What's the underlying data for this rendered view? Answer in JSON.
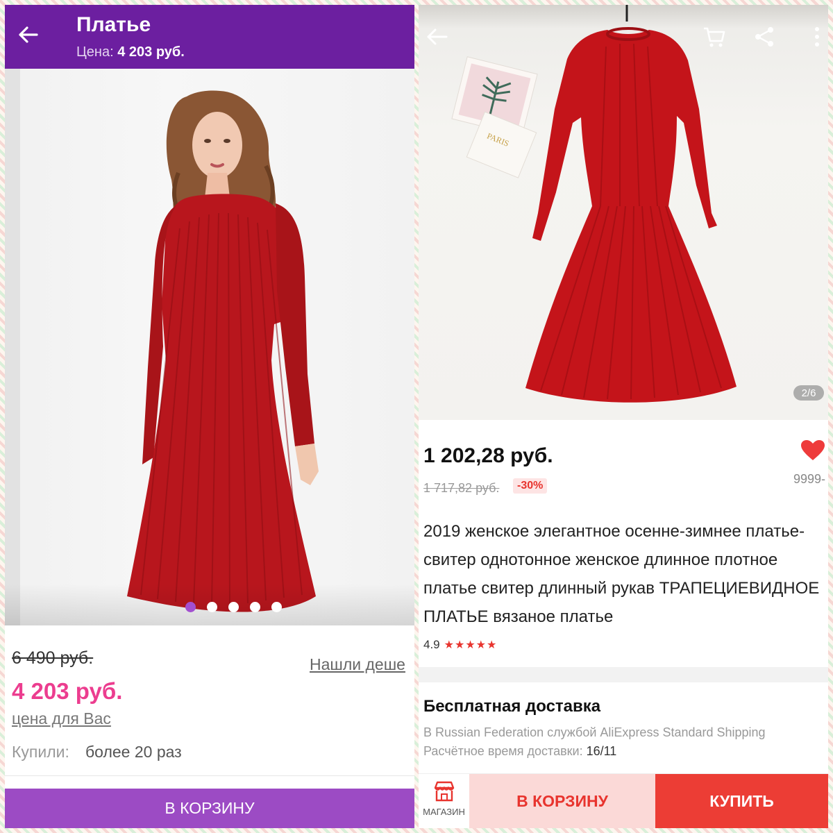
{
  "left": {
    "header": {
      "title": "Платье",
      "price_label": "Цена:",
      "price_value": "4 203 руб."
    },
    "gallery": {
      "dots_count": 5,
      "active_index": 0
    },
    "old_price": "6 490 руб.",
    "found_cheaper": "Нашли деше",
    "price": "4 203 руб.",
    "price_for_you": "цена для Вас",
    "bought_label": "Купили:",
    "bought_value": "более 20 раз",
    "cart_button": "В КОРЗИНУ"
  },
  "right": {
    "photo_counter": "2/6",
    "price": "1 202,28 руб.",
    "old_price": "1 717,82 руб.",
    "discount": "-30%",
    "likes": "9999-",
    "description": "2019 женское элегантное осенне-зимнее платье-свитер однотонное женское длинное плотное платье свитер длинный рукав ТРАПЕЦИЕВИДНОЕ ПЛАТЬЕ вязаное платье",
    "rating": "4.9",
    "stars": "★★★★★",
    "shipping": {
      "title": "Бесплатная доставка",
      "line1": "В Russian Federation службой AliExpress Standard Shipping",
      "eta_label": "Расчётное время доставки:",
      "eta_value": "16/11"
    },
    "bottom_bar": {
      "store_label": "МАГАЗИН",
      "cart_button": "В КОРЗИНУ",
      "buy_button": "КУПИТЬ"
    },
    "icons": [
      "back-arrow-icon",
      "cart-icon",
      "share-icon",
      "more-icon",
      "heart-icon",
      "store-icon"
    ]
  },
  "colors": {
    "purple_header": "#6c1fa0",
    "purple_button": "#9c4bc4",
    "pink_price": "#ec3d8f",
    "ali_red": "#ec3d35",
    "dress_red": "#b8161d"
  }
}
